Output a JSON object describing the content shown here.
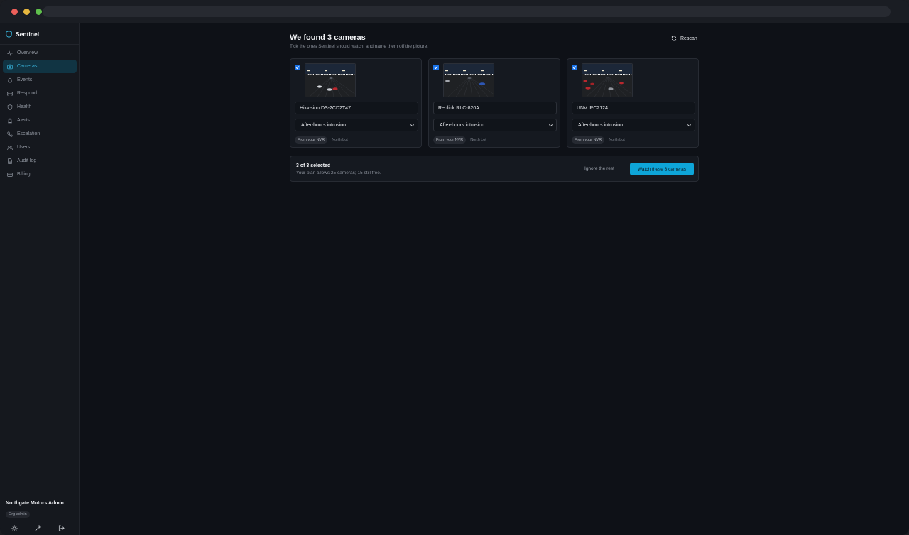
{
  "app": {
    "name": "Sentinel"
  },
  "sidebar": {
    "items": [
      {
        "label": "Overview",
        "icon": "activity-icon"
      },
      {
        "label": "Cameras",
        "icon": "camera-icon",
        "active": true
      },
      {
        "label": "Events",
        "icon": "bell-icon"
      },
      {
        "label": "Respond",
        "icon": "broadcast-icon"
      },
      {
        "label": "Health",
        "icon": "shield-icon"
      },
      {
        "label": "Alerts",
        "icon": "siren-icon"
      },
      {
        "label": "Escalation",
        "icon": "phone-icon"
      },
      {
        "label": "Users",
        "icon": "users-icon"
      },
      {
        "label": "Audit log",
        "icon": "file-icon"
      },
      {
        "label": "Billing",
        "icon": "card-icon"
      }
    ],
    "user": {
      "name": "Northgate Motors Admin",
      "role": "Org admin"
    }
  },
  "main": {
    "title": "We found 3 cameras",
    "subtitle": "Tick the ones Sentinel should watch, and name them off the picture.",
    "rescan_label": "Rescan",
    "cameras": [
      {
        "checked": true,
        "name": "Hikvision DS-2CD2T47",
        "profile": "After-hours intrusion",
        "source": "From your NVR",
        "location": "North Lot"
      },
      {
        "checked": true,
        "name": "Reolink RLC-820A",
        "profile": "After-hours intrusion",
        "source": "From your NVR",
        "location": "North Lot"
      },
      {
        "checked": true,
        "name": "UNV IPC2124",
        "profile": "After-hours intrusion",
        "source": "From your NVR",
        "location": "North Lot"
      }
    ],
    "footer": {
      "selected_text": "3 of 3 selected",
      "plan_text": "Your plan allows 25 cameras; 15 still free.",
      "ignore_label": "Ignore the rest",
      "watch_label": "Watch these 3 cameras"
    }
  },
  "colors": {
    "accent": "#0ea5d8",
    "active_nav_bg": "#113443",
    "checkbox": "#1a73e8"
  }
}
